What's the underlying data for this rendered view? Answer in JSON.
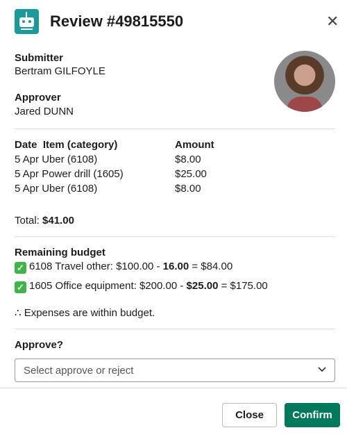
{
  "header": {
    "title": "Review #49815550",
    "logo_icon": "robot-icon",
    "close_icon": "close-icon"
  },
  "submitter": {
    "label": "Submitter",
    "name": "Bertram GILFOYLE"
  },
  "approver": {
    "label": "Approver",
    "name": "Jared DUNN"
  },
  "table": {
    "headers": [
      "Date  Item (category)",
      "Amount"
    ],
    "rows": [
      {
        "item": "5 Apr Uber (6108)",
        "amount": "$8.00"
      },
      {
        "item": "5 Apr Power drill (1605)",
        "amount": "$25.00"
      },
      {
        "item": "5 Apr Uber (6108)",
        "amount": "$8.00"
      }
    ]
  },
  "total": {
    "label": "Total: ",
    "value": "$41.00"
  },
  "budget": {
    "label": "Remaining budget",
    "items": [
      {
        "prefix": "6108 Travel other: $100.00 - ",
        "spent": "16.00",
        "suffix": " = $84.00"
      },
      {
        "prefix": "1605 Office equipment: $200.00 - ",
        "spent": "$25.00",
        "suffix": " = $175.00"
      }
    ],
    "conclusion": "∴ Expenses are within budget."
  },
  "approve": {
    "label": "Approve?",
    "placeholder": "Select approve or reject"
  },
  "buttons": {
    "close": "Close",
    "confirm": "Confirm"
  },
  "colors": {
    "confirm": "#007a5a",
    "check": "#3fb547",
    "logo": "#1a9a9a"
  }
}
